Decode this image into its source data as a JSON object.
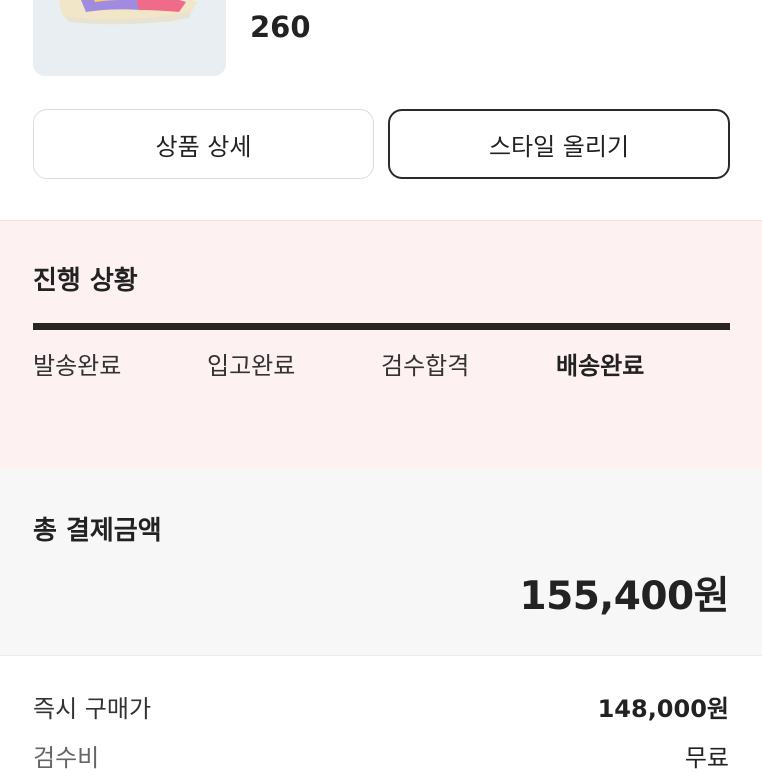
{
  "product": {
    "size": "260"
  },
  "buttons": {
    "detail_label": "상품 상세",
    "style_label": "스타일 올리기"
  },
  "progress": {
    "title": "진행 상황",
    "steps": [
      "발송완료",
      "입고완료",
      "검수합격",
      "배송완료"
    ],
    "current_step": "배송완료"
  },
  "payment": {
    "title": "총 결제금액",
    "amount": "155,400원"
  },
  "details": [
    {
      "label": "즉시 구매가",
      "value": "148,000원"
    },
    {
      "label": "검수비",
      "value": "무료"
    }
  ]
}
